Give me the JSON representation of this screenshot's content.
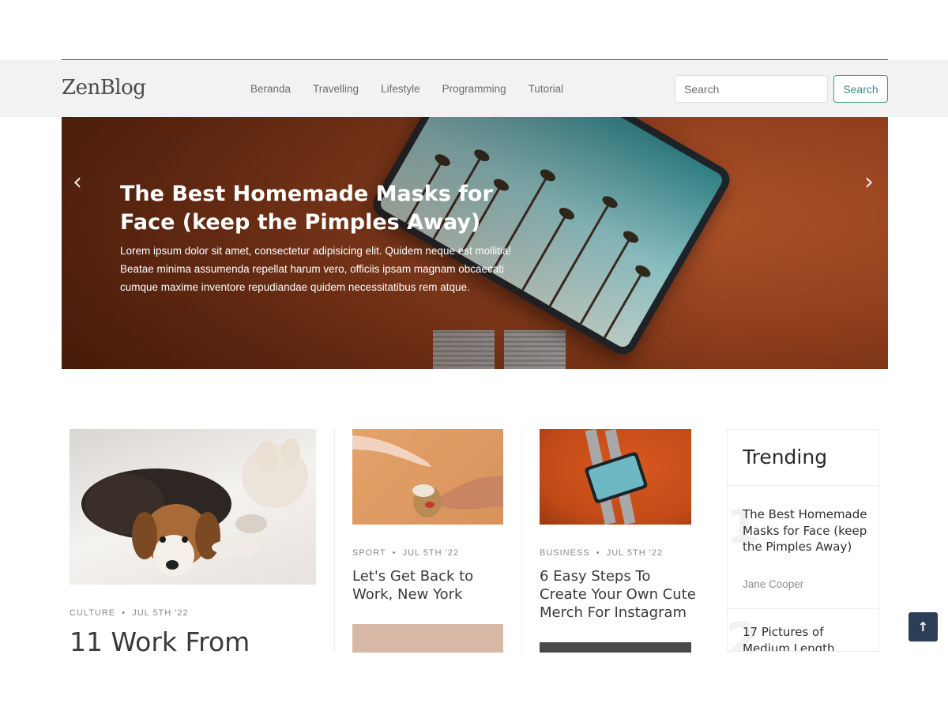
{
  "header": {
    "brand": "ZenBlog",
    "nav": [
      "Beranda",
      "Travelling",
      "Lifestyle",
      "Programming",
      "Tutorial"
    ],
    "search_placeholder": "Search",
    "search_button": "Search"
  },
  "hero": {
    "prev_icon": "‹",
    "next_icon": "›",
    "title": "The Best Homemade Masks for Face (keep the Pimples Away)",
    "text": "Lorem ipsum dolor sit amet, consectetur adipisicing elit. Quidem neque est mollitia! Beatae minima assumenda repellat harum vero, officiis ipsam magnam obcaecati cumque maxime inventore repudiandae quidem necessitatibus rem atque."
  },
  "posts": [
    {
      "category": "Culture",
      "date": "Jul 5th '22",
      "title": "11 Work From"
    },
    {
      "category": "Sport",
      "date": "Jul 5th '22",
      "title": "Let's Get Back to Work, New York"
    },
    {
      "category": "Business",
      "date": "Jul 5th '22",
      "title": "6 Easy Steps To Create Your Own Cute Merch For Instagram"
    }
  ],
  "trending": {
    "heading": "Trending",
    "items": [
      {
        "number": "1",
        "title": "The Best Homemade Masks for Face (keep the Pimples Away)",
        "author": "Jane Cooper"
      },
      {
        "number": "2",
        "title": "17 Pictures of Medium Length"
      }
    ]
  },
  "scroll_top_icon": "↑",
  "icons": {
    "prev": "chevron-left-icon",
    "next": "chevron-right-icon",
    "scroll_top": "arrow-up-icon"
  }
}
